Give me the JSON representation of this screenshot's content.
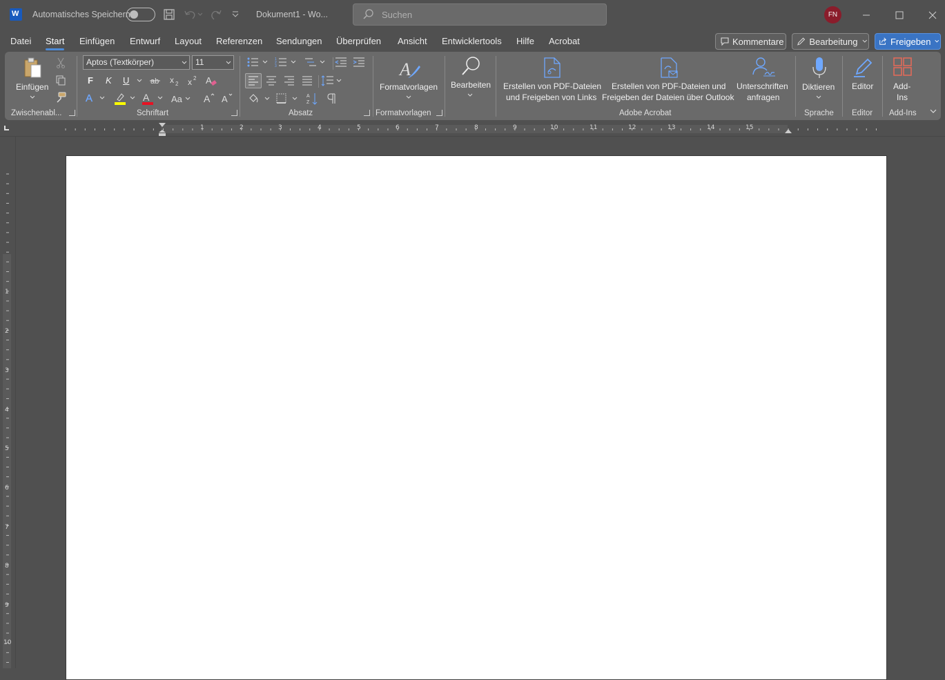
{
  "titlebar": {
    "autosave_label": "Automatisches Speichern",
    "doc_title": "Dokument1  -  Wo...",
    "search_placeholder": "Suchen",
    "user_initials": "FN"
  },
  "tabs": [
    "Datei",
    "Start",
    "Einfügen",
    "Entwurf",
    "Layout",
    "Referenzen",
    "Sendungen",
    "Überprüfen",
    "Ansicht",
    "Entwicklertools",
    "Hilfe",
    "Acrobat"
  ],
  "active_tab": "Start",
  "actions": {
    "comments": "Kommentare",
    "editing": "Bearbeitung",
    "share": "Freigeben"
  },
  "ribbon": {
    "clipboard": {
      "paste": "Einfügen",
      "label": "Zwischenabl..."
    },
    "font": {
      "name": "Aptos (Textkörper)",
      "size": "11",
      "bold": "F",
      "italic": "K",
      "underline": "U",
      "label": "Schriftart"
    },
    "paragraph": {
      "label": "Absatz"
    },
    "styles": {
      "button": "Formatvorlagen",
      "label": "Formatvorlagen"
    },
    "editing": {
      "button": "Bearbeiten"
    },
    "acrobat": {
      "pdf_links_line1": "Erstellen von PDF-Dateien",
      "pdf_links_line2": "und Freigeben von Links",
      "pdf_outlook_line1": "Erstellen von PDF-Dateien und",
      "pdf_outlook_line2": "Freigeben der Dateien über Outlook",
      "sign_line1": "Unterschriften",
      "sign_line2": "anfragen",
      "label": "Adobe Acrobat"
    },
    "voice": {
      "button": "Diktieren",
      "label": "Sprache"
    },
    "editor": {
      "button": "Editor",
      "label": "Editor"
    },
    "addins": {
      "line1": "Add-",
      "line2": "Ins",
      "label": "Add-Ins"
    }
  },
  "ruler": {
    "h_numbers": [
      "1",
      "1",
      "2",
      "3",
      "4",
      "5",
      "6",
      "7",
      "8",
      "9",
      "10",
      "11",
      "12",
      "13",
      "14",
      "15"
    ],
    "v_numbers": [
      "1",
      "2",
      "3",
      "4",
      "5",
      "6",
      "7",
      "8",
      "9",
      "10"
    ]
  },
  "colors": {
    "accent": "#4c8bd8",
    "highlight": "#ffff00",
    "font_color": "#e81123",
    "avatar": "#8a1c2b",
    "word_icon": "#185abd"
  }
}
